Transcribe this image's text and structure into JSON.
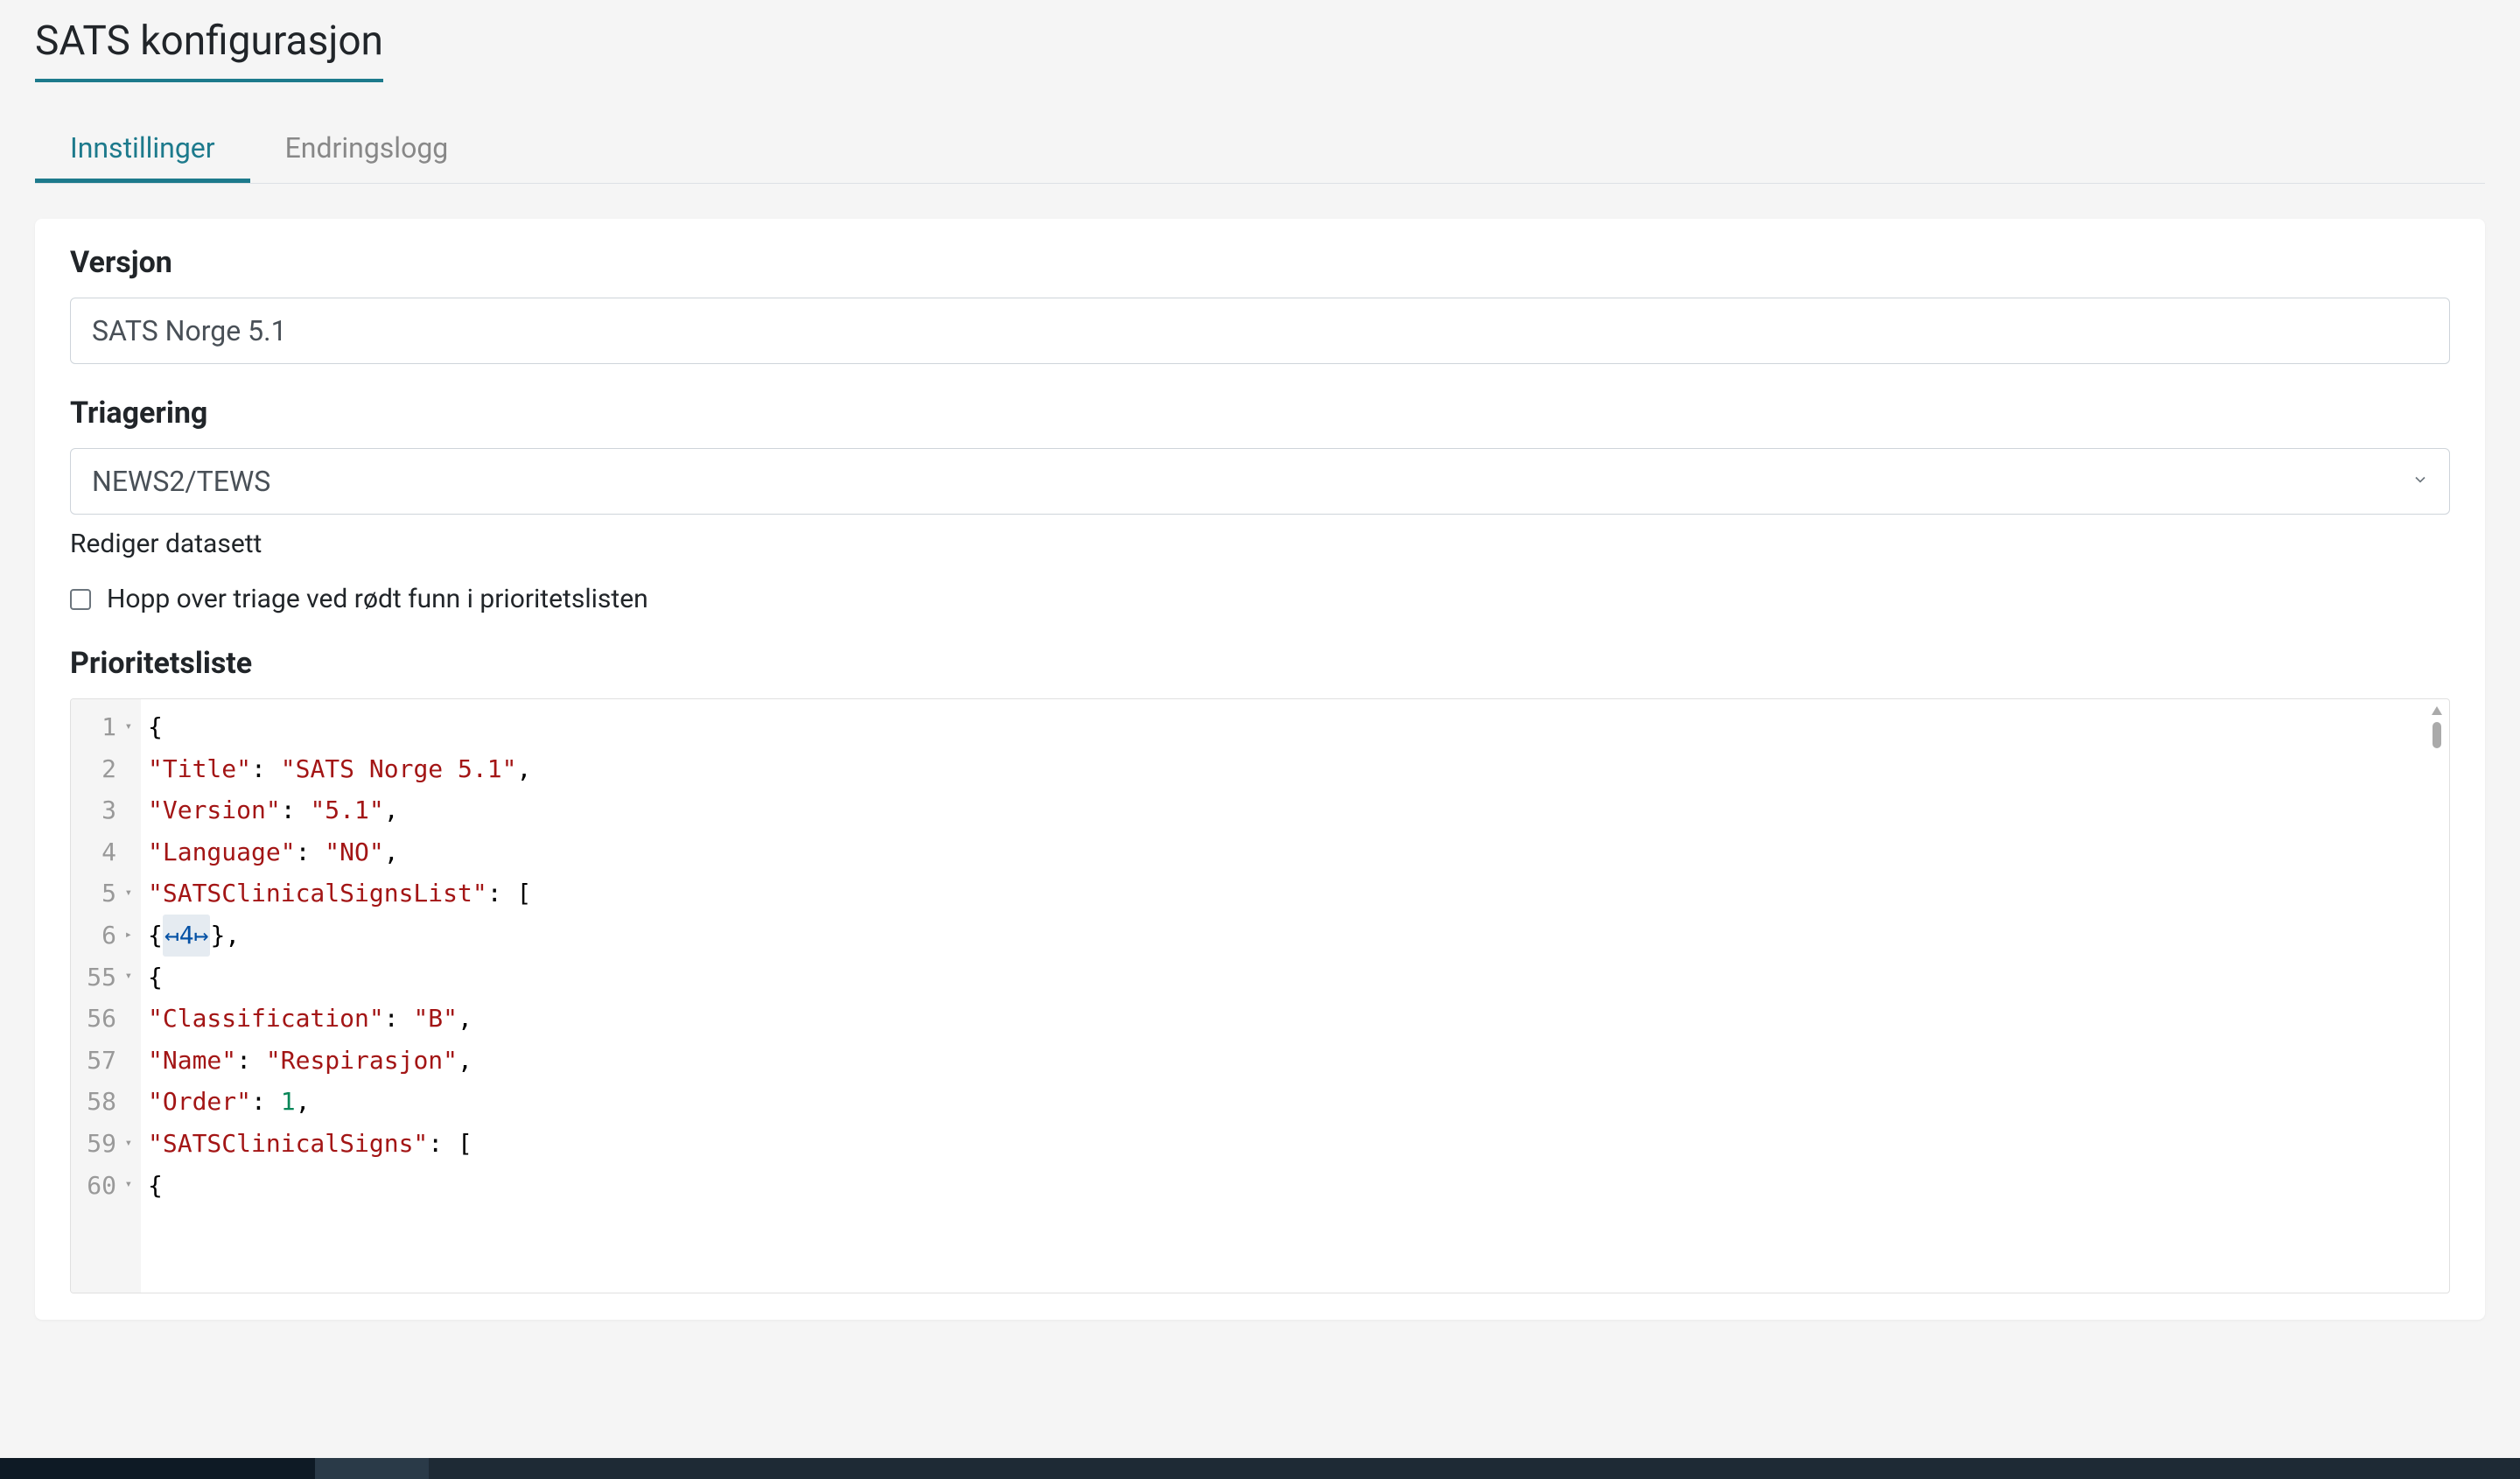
{
  "page": {
    "title": "SATS konfigurasjon"
  },
  "tabs": {
    "settings": "Innstillinger",
    "changelog": "Endringslogg"
  },
  "form": {
    "version_label": "Versjon",
    "version_value": "SATS Norge 5.1",
    "triage_label": "Triagering",
    "triage_value": "NEWS2/TEWS",
    "edit_dataset": "Rediger datasett",
    "skip_triage_label": "Hopp over triage ved rødt funn i prioritetslisten",
    "priority_list_label": "Prioritetsliste"
  },
  "editor": {
    "line_numbers": [
      "1",
      "2",
      "3",
      "4",
      "5",
      "6",
      "55",
      "56",
      "57",
      "58",
      "59",
      "60"
    ],
    "fold_markers": [
      "▾",
      "",
      "",
      "",
      "▾",
      "▸",
      "▾",
      "",
      "",
      "",
      "▾",
      "▾"
    ],
    "fold_badge": "↤4↦",
    "priority_list_content": {
      "Title": "SATS Norge 5.1",
      "Version": "5.1",
      "Language": "NO",
      "SATSClinicalSignsList": [
        {
          "Classification": "B",
          "Name": "Respirasjon",
          "Order": 1,
          "SATSClinicalSigns": []
        }
      ]
    }
  }
}
